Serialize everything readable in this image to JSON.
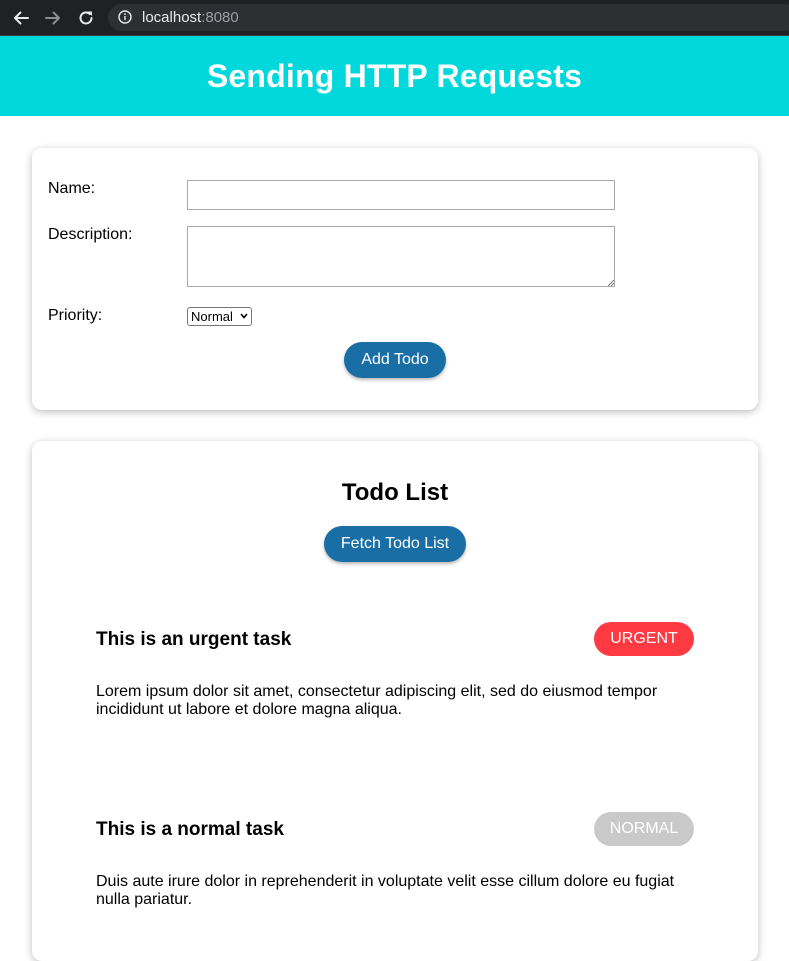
{
  "browser": {
    "url_host": "localhost",
    "url_port": ":8080"
  },
  "header": {
    "title": "Sending HTTP Requests",
    "background": "#00d8dc"
  },
  "form": {
    "name_label": "Name:",
    "name_value": "",
    "description_label": "Description:",
    "description_value": "",
    "priority_label": "Priority:",
    "priority_selected": "Normal",
    "submit_label": "Add Todo"
  },
  "todo_list": {
    "title": "Todo List",
    "fetch_label": "Fetch Todo List",
    "items": [
      {
        "name": "This is an urgent task",
        "priority": "URGENT",
        "priority_color": "#ff3a43",
        "description": "Lorem ipsum dolor sit amet, consectetur adipiscing elit, sed do eiusmod tempor incididunt ut labore et dolore magna aliqua."
      },
      {
        "name": "This is a normal task",
        "priority": "NORMAL",
        "priority_color": "#c9c9c9",
        "description": "Duis aute irure dolor in reprehenderit in voluptate velit esse cillum dolore eu fugiat nulla pariatur."
      }
    ]
  },
  "colors": {
    "button": "#1a6ea6"
  },
  "icons": [
    "back-arrow-icon",
    "forward-arrow-icon",
    "reload-icon",
    "info-icon",
    "chevron-down-icon",
    "resize-grip-icon"
  ]
}
